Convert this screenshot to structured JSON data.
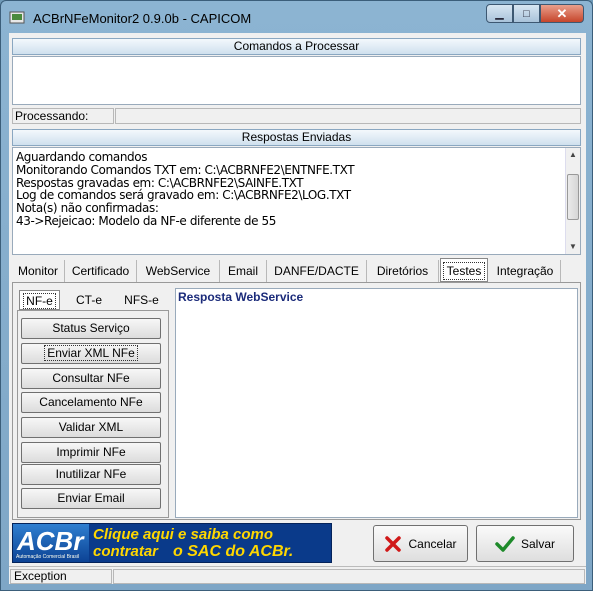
{
  "window": {
    "title": "ACBrNFeMonitor2 0.9.0b - CAPICOM"
  },
  "sections": {
    "commands_header": "Comandos a Processar",
    "processing_label": "Processando:",
    "responses_header": "Respostas Enviadas"
  },
  "log_lines": [
    "Aguardando comandos",
    "Monitorando Comandos TXT em: C:\\ACBRNFE2\\ENTNFE.TXT",
    "Respostas gravadas em: C:\\ACBRNFE2\\SAINFE.TXT",
    "Log de comandos será gravado em: C:\\ACBRNFE2\\LOG.TXT",
    "Nota(s) não confirmadas:",
    "43->Rejeicao: Modelo da NF-e diferente de 55"
  ],
  "tabs": [
    "Monitor",
    "Certificado",
    "WebService",
    "Email",
    "DANFE/DACTE",
    "Diretórios",
    "Testes",
    "Integração"
  ],
  "active_tab": "Testes",
  "subtabs": [
    "NF-e",
    "CT-e",
    "NFS-e"
  ],
  "active_subtab": "NF-e",
  "actions": [
    "Status Serviço",
    "Enviar XML NFe",
    "Consultar NFe",
    "Cancelamento NFe",
    "Validar XML",
    "Imprimir NFe",
    "Inutilizar NFe",
    "Enviar Email"
  ],
  "response_panel": {
    "title": "Resposta WebService"
  },
  "banner": {
    "logo_text": "ACBr",
    "logo_sub": "Automação Comercial Brasil",
    "line1": "Clique aqui e saiba como contratar",
    "line2": "o SAC do ACBr."
  },
  "buttons": {
    "cancel": "Cancelar",
    "save": "Salvar"
  },
  "status": {
    "text": "Exception"
  },
  "colors": {
    "banner_bg": "#0a3a8a",
    "promo_text": "#ffd700",
    "panel_header": "#cfe0ee"
  }
}
